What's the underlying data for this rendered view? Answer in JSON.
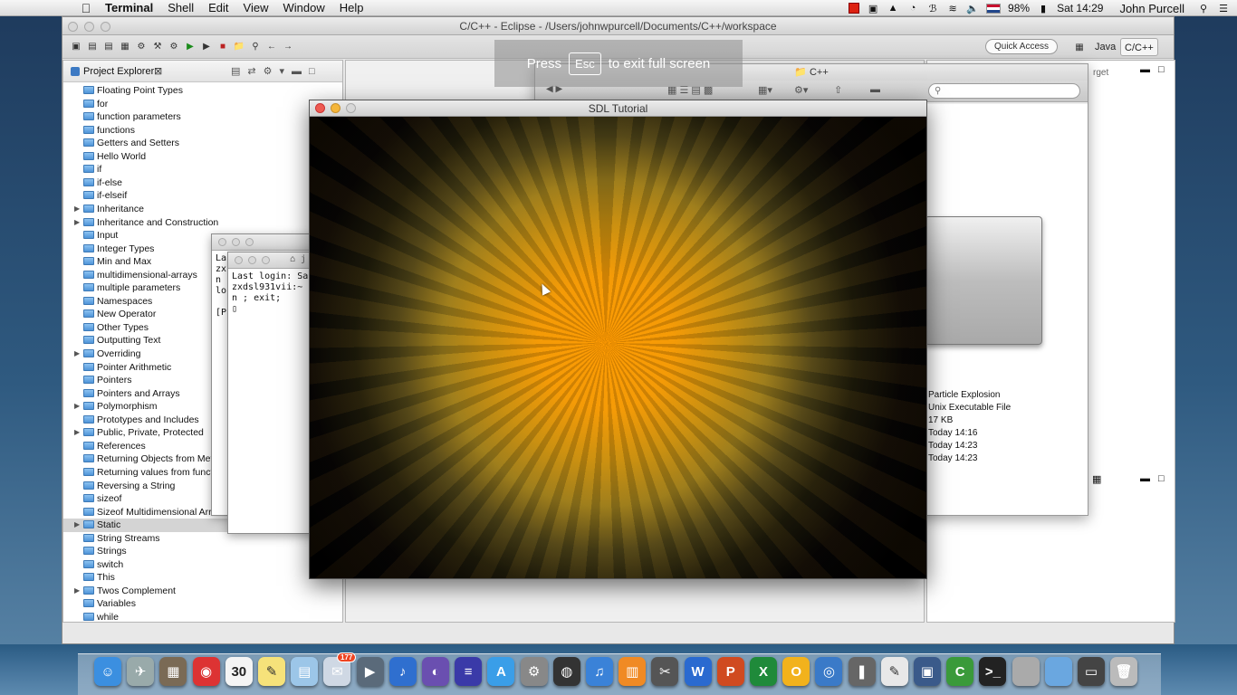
{
  "menubar": {
    "app_name": "Terminal",
    "menus": [
      "Shell",
      "Edit",
      "View",
      "Window",
      "Help"
    ],
    "battery": "98%",
    "clock": "Sat 14:29",
    "user": "John Purcell"
  },
  "eclipse": {
    "title": "C/C++ - Eclipse - /Users/johnwpurcell/Documents/C++/workspace",
    "quick_access": "Quick Access",
    "perspectives": [
      "Java",
      "C/C++"
    ],
    "right_view_partial": "rget"
  },
  "explorer": {
    "tab_label": "Project Explorer",
    "close_glyph": "⊠",
    "items": [
      {
        "label": "Floating Point Types",
        "expandable": false,
        "selected": false
      },
      {
        "label": "for",
        "expandable": false,
        "selected": false
      },
      {
        "label": "function parameters",
        "expandable": false,
        "selected": false
      },
      {
        "label": "functions",
        "expandable": false,
        "selected": false
      },
      {
        "label": "Getters and Setters",
        "expandable": false,
        "selected": false
      },
      {
        "label": "Hello World",
        "expandable": false,
        "selected": false
      },
      {
        "label": "if",
        "expandable": false,
        "selected": false
      },
      {
        "label": "if-else",
        "expandable": false,
        "selected": false
      },
      {
        "label": "if-elseif",
        "expandable": false,
        "selected": false
      },
      {
        "label": "Inheritance",
        "expandable": true,
        "selected": false
      },
      {
        "label": "Inheritance and Construction",
        "expandable": true,
        "selected": false
      },
      {
        "label": "Input",
        "expandable": false,
        "selected": false
      },
      {
        "label": "Integer Types",
        "expandable": false,
        "selected": false
      },
      {
        "label": "Min and Max",
        "expandable": false,
        "selected": false
      },
      {
        "label": "multidimensional-arrays",
        "expandable": false,
        "selected": false
      },
      {
        "label": "multiple parameters",
        "expandable": false,
        "selected": false
      },
      {
        "label": "Namespaces",
        "expandable": false,
        "selected": false
      },
      {
        "label": "New Operator",
        "expandable": false,
        "selected": false
      },
      {
        "label": "Other Types",
        "expandable": false,
        "selected": false
      },
      {
        "label": "Outputting Text",
        "expandable": false,
        "selected": false
      },
      {
        "label": "Overriding",
        "expandable": true,
        "selected": false
      },
      {
        "label": "Pointer Arithmetic",
        "expandable": false,
        "selected": false
      },
      {
        "label": "Pointers",
        "expandable": false,
        "selected": false
      },
      {
        "label": "Pointers and Arrays",
        "expandable": false,
        "selected": false
      },
      {
        "label": "Polymorphism",
        "expandable": true,
        "selected": false
      },
      {
        "label": "Prototypes and Includes",
        "expandable": false,
        "selected": false
      },
      {
        "label": "Public, Private, Protected",
        "expandable": true,
        "selected": false
      },
      {
        "label": "References",
        "expandable": false,
        "selected": false
      },
      {
        "label": "Returning Objects from Meth",
        "expandable": false,
        "selected": false
      },
      {
        "label": "Returning values from functi",
        "expandable": false,
        "selected": false
      },
      {
        "label": "Reversing a String",
        "expandable": false,
        "selected": false
      },
      {
        "label": "sizeof",
        "expandable": false,
        "selected": false
      },
      {
        "label": "Sizeof Multidimensional Arra",
        "expandable": false,
        "selected": false
      },
      {
        "label": "Static",
        "expandable": true,
        "selected": true
      },
      {
        "label": "String Streams",
        "expandable": false,
        "selected": false
      },
      {
        "label": "Strings",
        "expandable": false,
        "selected": false
      },
      {
        "label": "switch",
        "expandable": false,
        "selected": false
      },
      {
        "label": "This",
        "expandable": false,
        "selected": false
      },
      {
        "label": "Twos Complement",
        "expandable": true,
        "selected": false
      },
      {
        "label": "Variables",
        "expandable": false,
        "selected": false
      },
      {
        "label": "while",
        "expandable": false,
        "selected": false
      }
    ]
  },
  "finder": {
    "folder_title": "C++",
    "file_info": [
      "Particle Explosion",
      "Unix Executable File",
      "17 KB",
      "Today 14:16",
      "Today 14:23",
      "Today 14:23"
    ]
  },
  "terminal_back": {
    "lines": [
      "La",
      "zx",
      "n",
      "lo",
      "",
      "[P"
    ]
  },
  "terminal_front": {
    "title_partial": "j",
    "lines": [
      "Last login: Sa",
      "zxdsl931vii:~",
      "n ; exit;",
      "▯"
    ]
  },
  "sdl": {
    "title": "SDL Tutorial",
    "colors": {
      "core": "#ff9a00",
      "mid": "#9a7c1c",
      "edge": "#000000"
    }
  },
  "fullscreen_hint": {
    "press": "Press",
    "key": "Esc",
    "rest": "to exit full screen"
  },
  "dock": {
    "calendar_day": "30",
    "mail_badge": "177"
  }
}
